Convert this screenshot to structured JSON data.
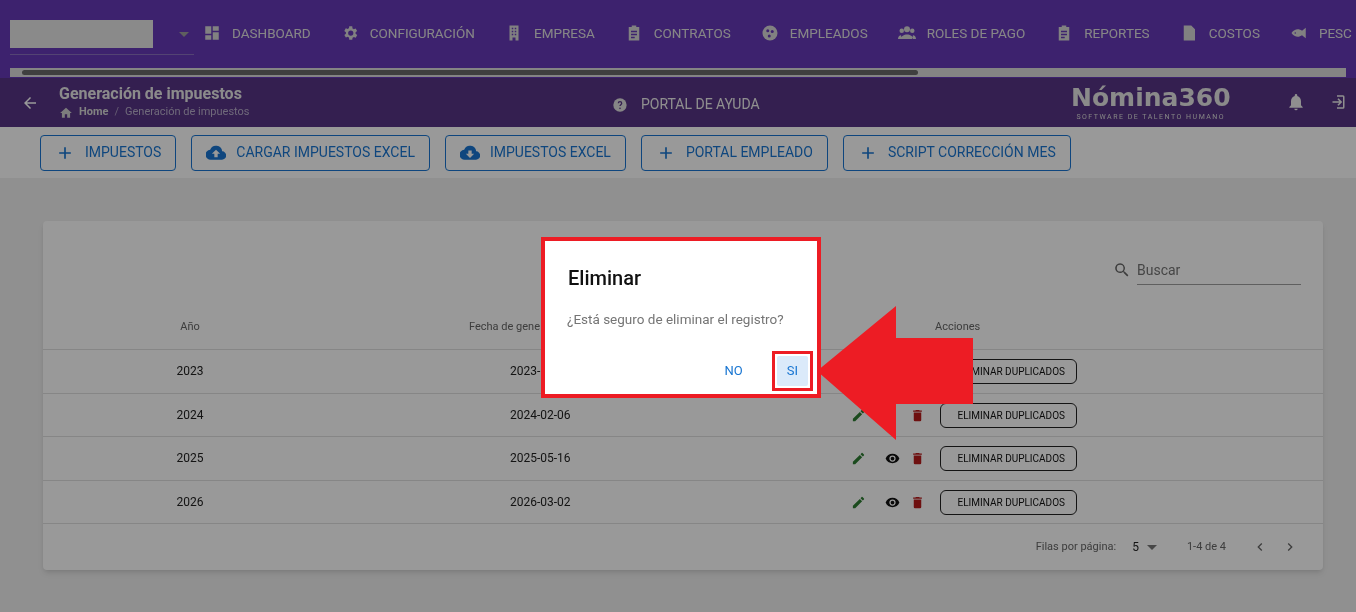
{
  "nav": {
    "items": [
      {
        "label": "DASHBOARD"
      },
      {
        "label": "CONFIGURACIÓN"
      },
      {
        "label": "EMPRESA"
      },
      {
        "label": "CONTRATOS"
      },
      {
        "label": "EMPLEADOS"
      },
      {
        "label": "ROLES DE PAGO"
      },
      {
        "label": "REPORTES"
      },
      {
        "label": "COSTOS"
      },
      {
        "label": "PESC"
      }
    ]
  },
  "header": {
    "title": "Generación de impuestos",
    "breadcrumb": [
      "Home",
      "Generación de impuestos"
    ],
    "breadcrumb_separator": "/",
    "help": "PORTAL DE AYUDA",
    "logo": "Nómina360",
    "logo_tagline": "SOFTWARE DE TALENTO HUMANO"
  },
  "toolbar": [
    {
      "kind": "add",
      "label": "IMPUESTOS"
    },
    {
      "kind": "upload",
      "label": "CARGAR IMPUESTOS EXCEL"
    },
    {
      "kind": "download",
      "label": "IMPUESTOS EXCEL"
    },
    {
      "kind": "add",
      "label": "PORTAL EMPLEADO"
    },
    {
      "kind": "add",
      "label": "SCRIPT CORRECCIÓN MES"
    }
  ],
  "table": {
    "search": {
      "placeholder": "Buscar"
    },
    "columns": [
      "Año",
      "Fecha de gene",
      "Acciones"
    ],
    "rows": [
      {
        "year": "2023",
        "date": "2023-",
        "button": "MINAR DUPLICADOS"
      },
      {
        "year": "2024",
        "date": "2024-02-06",
        "actions": [
          {
            "kind": "edit"
          },
          {
            "kind": "delete"
          }
        ],
        "button": "ELIMINAR DUPLICADOS"
      },
      {
        "year": "2025",
        "date": "2025-05-16",
        "actions": [
          {
            "kind": "edit"
          },
          {
            "kind": "view"
          },
          {
            "kind": "delete"
          }
        ],
        "button": "ELIMINAR DUPLICADOS"
      },
      {
        "year": "2026",
        "date": "2026-03-02",
        "actions": [
          {
            "kind": "edit"
          },
          {
            "kind": "view"
          },
          {
            "kind": "delete"
          }
        ],
        "button": "ELIMINAR DUPLICADOS"
      }
    ],
    "pagination": {
      "rows_label": "Filas por página:",
      "rows_value": "5",
      "range": "1-4 de 4"
    }
  },
  "dialog": {
    "title": "Eliminar",
    "message": "¿Está seguro de eliminar el registro?",
    "buttons": [
      {
        "label": "NO",
        "focused": false,
        "highlighted": false
      },
      {
        "label": "SI",
        "focused": true,
        "highlighted": true
      }
    ]
  }
}
